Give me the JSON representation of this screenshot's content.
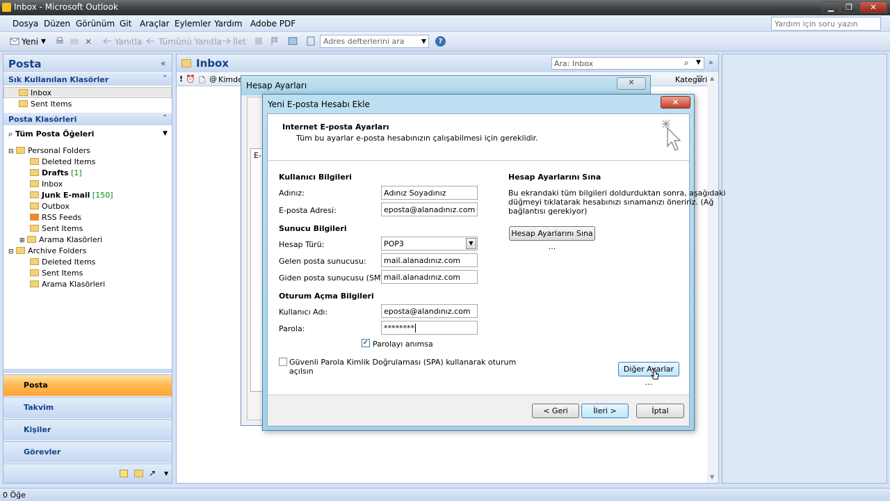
{
  "window": {
    "title": "Inbox - Microsoft Outlook"
  },
  "menu": [
    "Dosya",
    "Düzen",
    "Görünüm",
    "Git",
    "Araçlar",
    "Eylemler",
    "Yardım",
    "Adobe PDF"
  ],
  "help_placeholder": "Yardım için soru yazın",
  "toolbar": {
    "new": "Yeni",
    "reply": "Yanıtla",
    "reply_all": "Tümünü Yanıtla",
    "forward": "İlet",
    "address_search": "Adres defterlerini ara"
  },
  "nav": {
    "title": "Posta",
    "favorites_header": "Sık Kullanılan Klasörler",
    "favorites": [
      "Inbox",
      "Sent Items"
    ],
    "folders_header": "Posta Klasörleri",
    "all_items": "Tüm Posta Öğeleri",
    "tree": [
      {
        "label": "Personal Folders",
        "count": ""
      },
      {
        "label": "Deleted Items",
        "count": ""
      },
      {
        "label": "Drafts",
        "count": "[1]"
      },
      {
        "label": "Inbox",
        "count": ""
      },
      {
        "label": "Junk E-mail",
        "count": "[150]"
      },
      {
        "label": "Outbox",
        "count": ""
      },
      {
        "label": "RSS Feeds",
        "count": ""
      },
      {
        "label": "Sent Items",
        "count": ""
      },
      {
        "label": "Arama Klasörleri",
        "count": ""
      },
      {
        "label": "Archive Folders",
        "count": ""
      },
      {
        "label": "Deleted Items",
        "count": ""
      },
      {
        "label": "Sent Items",
        "count": ""
      },
      {
        "label": "Arama Klasörleri",
        "count": ""
      }
    ],
    "buttons": [
      "Posta",
      "Takvim",
      "Kişiler",
      "Görevler"
    ]
  },
  "inbox": {
    "title": "Inbox",
    "search_placeholder": "Ara: Inbox",
    "col_from": "Kimden",
    "col_categories": "Kategoriler"
  },
  "status": "0 Öğe",
  "dialog_back": {
    "title": "Hesap Ayarları",
    "tab_fragment": "E-"
  },
  "dialog": {
    "title": "Yeni E-posta Hesabı Ekle",
    "heading": "Internet E-posta Ayarları",
    "subheading": "Tüm bu ayarlar e-posta hesabınızın çalışabilmesi için gereklidir.",
    "user_section": "Kullanıcı Bilgileri",
    "name_label": "Adınız:",
    "name_value": "Adınız Soyadınız",
    "email_label": "E-posta Adresi:",
    "email_value": "eposta@alanadınız.com",
    "server_section": "Sunucu Bilgileri",
    "account_type_label": "Hesap Türü:",
    "account_type_value": "POP3",
    "incoming_label": "Gelen posta sunucusu:",
    "incoming_value": "mail.alanadınız.com",
    "outgoing_label": "Giden posta sunucusu (SMTP):",
    "outgoing_value": "mail.alanadınız.com",
    "logon_section": "Oturum Açma Bilgileri",
    "username_label": "Kullanıcı Adı:",
    "username_value": "eposta@alandınız.com",
    "password_label": "Parola:",
    "password_value": "********",
    "remember_label": "Parolayı anımsa",
    "spa_label_1": "Güvenli Parola Kimlik Doğrulaması (SPA) kullanarak oturum",
    "spa_label_2": "açılsın",
    "test_section": "Hesap Ayarlarını Sına",
    "test_desc_1": "Bu ekrandaki tüm bilgileri doldurduktan sonra, aşağıdaki",
    "test_desc_2": "düğmeyi tıklatarak hesabınızı sınamanızı öneririz. (Ağ",
    "test_desc_3": "bağlantısı gerekiyor)",
    "test_button": "Hesap Ayarlarını Sına ...",
    "more_settings": "Diğer Ayarlar ...",
    "back": "< Geri",
    "next": "İleri >",
    "cancel": "İptal"
  }
}
